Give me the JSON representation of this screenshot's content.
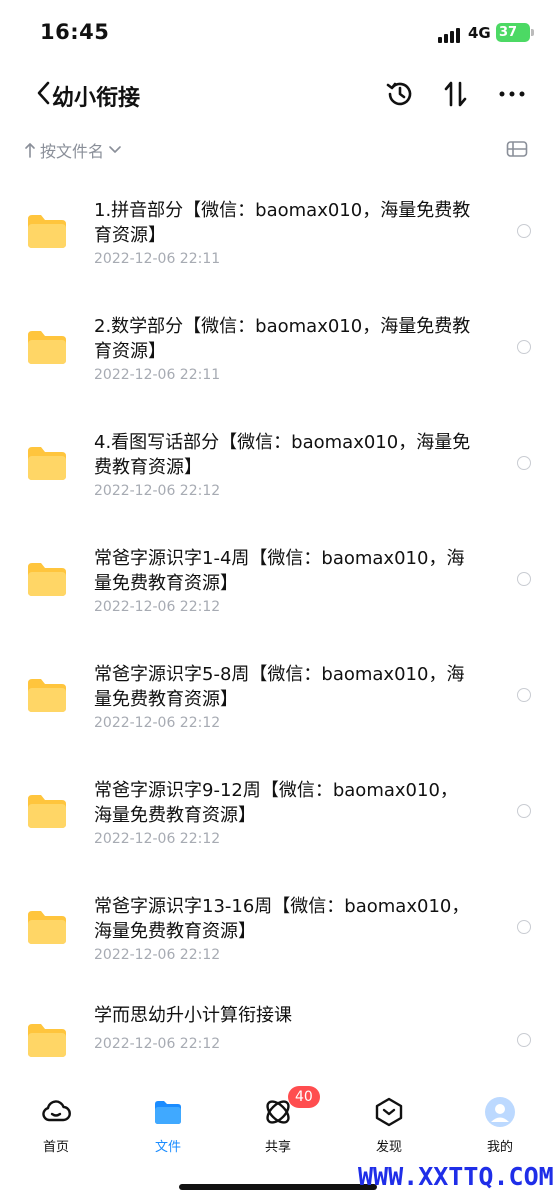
{
  "status": {
    "time": "16:45",
    "network": "4G",
    "battery": "37"
  },
  "header": {
    "title": "幼小衔接"
  },
  "sort": {
    "label": "按文件名"
  },
  "files": [
    {
      "name": "1.拼音部分【微信：baomax010，海量免费教育资源】",
      "date": "2022-12-06 22:11"
    },
    {
      "name": "2.数学部分【微信：baomax010，海量免费教育资源】",
      "date": "2022-12-06 22:11"
    },
    {
      "name": "4.看图写话部分【微信：baomax010，海量免费教育资源】",
      "date": "2022-12-06 22:12"
    },
    {
      "name": "常爸字源识字1-4周【微信：baomax010，海量免费教育资源】",
      "date": "2022-12-06 22:12"
    },
    {
      "name": "常爸字源识字5-8周【微信：baomax010，海量免费教育资源】",
      "date": "2022-12-06 22:12"
    },
    {
      "name": "常爸字源识字9-12周【微信：baomax010，海量免费教育资源】",
      "date": "2022-12-06 22:12"
    },
    {
      "name": "常爸字源识字13-16周【微信：baomax010，海量免费教育资源】",
      "date": "2022-12-06 22:12"
    },
    {
      "name": "学而思幼升小计算衔接课",
      "date": "2022-12-06 22:12"
    }
  ],
  "nav": {
    "home": "首页",
    "files": "文件",
    "share": "共享",
    "share_badge": "40",
    "discover": "发现",
    "mine": "我的"
  },
  "colors": {
    "accent": "#1a8cff",
    "folder": "#ffc53d",
    "badge": "#ff4d4f"
  },
  "watermark": "WWW.XXTTQ.COM"
}
